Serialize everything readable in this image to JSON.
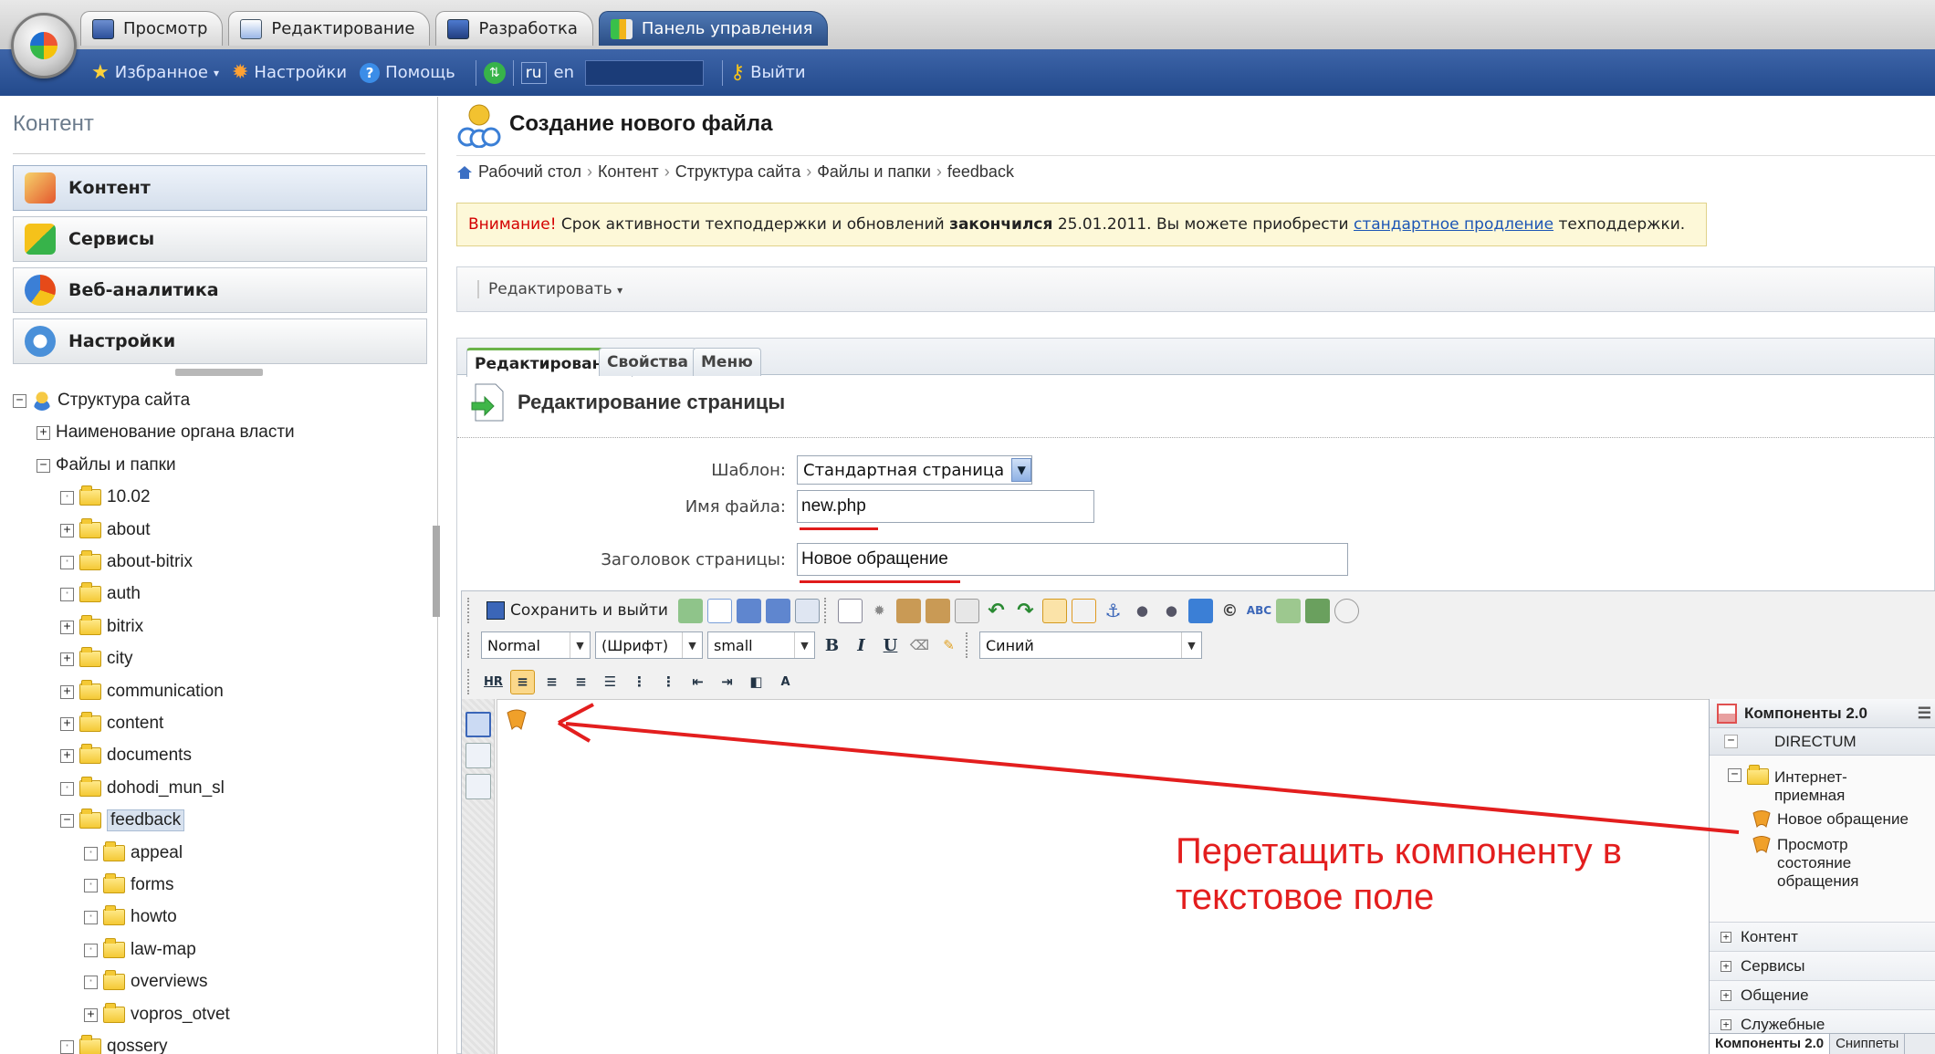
{
  "topbar": {
    "tabs": [
      {
        "label": "Просмотр",
        "icon": "view-icon"
      },
      {
        "label": "Редактирование",
        "icon": "edit-icon"
      },
      {
        "label": "Разработка",
        "icon": "develop-icon"
      },
      {
        "label": "Панель управления",
        "icon": "control-panel-icon"
      }
    ],
    "active_tab": "Панель управления",
    "favorites": "Избранное",
    "settings": "Настройки",
    "help": "Помощь",
    "lang_ru": "ru",
    "lang_en": "en",
    "logout": "Выйти"
  },
  "left": {
    "title": "Контент",
    "sections": [
      {
        "label": "Контент",
        "icon": "content-pencil-icon",
        "active": true
      },
      {
        "label": "Сервисы",
        "icon": "services-shapes-icon",
        "active": false
      },
      {
        "label": "Веб-аналитика",
        "icon": "analytics-pie-icon",
        "active": false
      },
      {
        "label": "Настройки",
        "icon": "settings-gear-icon",
        "active": false
      }
    ],
    "tree": [
      {
        "label": "Структура сайта",
        "level": 0,
        "toggle": "-",
        "kind": "site"
      },
      {
        "label": "Наименование органа власти",
        "level": 1,
        "toggle": "+",
        "kind": "none"
      },
      {
        "label": "Файлы и папки",
        "level": 1,
        "toggle": "-",
        "kind": "none"
      },
      {
        "label": "10.02",
        "level": 2,
        "toggle": " ",
        "kind": "folder"
      },
      {
        "label": "about",
        "level": 2,
        "toggle": "+",
        "kind": "folder"
      },
      {
        "label": "about-bitrix",
        "level": 2,
        "toggle": " ",
        "kind": "folder"
      },
      {
        "label": "auth",
        "level": 2,
        "toggle": " ",
        "kind": "folder"
      },
      {
        "label": "bitrix",
        "level": 2,
        "toggle": "+",
        "kind": "folder"
      },
      {
        "label": "city",
        "level": 2,
        "toggle": "+",
        "kind": "folder"
      },
      {
        "label": "communication",
        "level": 2,
        "toggle": "+",
        "kind": "folder"
      },
      {
        "label": "content",
        "level": 2,
        "toggle": "+",
        "kind": "folder"
      },
      {
        "label": "documents",
        "level": 2,
        "toggle": "+",
        "kind": "folder"
      },
      {
        "label": "dohodi_mun_sl",
        "level": 2,
        "toggle": " ",
        "kind": "folder"
      },
      {
        "label": "feedback",
        "level": 2,
        "toggle": "-",
        "kind": "folder",
        "selected": true
      },
      {
        "label": "appeal",
        "level": 3,
        "toggle": " ",
        "kind": "folder"
      },
      {
        "label": "forms",
        "level": 3,
        "toggle": " ",
        "kind": "folder"
      },
      {
        "label": "howto",
        "level": 3,
        "toggle": " ",
        "kind": "folder"
      },
      {
        "label": "law-map",
        "level": 3,
        "toggle": " ",
        "kind": "folder"
      },
      {
        "label": "overviews",
        "level": 3,
        "toggle": " ",
        "kind": "folder"
      },
      {
        "label": "vopros_otvet",
        "level": 3,
        "toggle": "+",
        "kind": "folder"
      },
      {
        "label": "qossery",
        "level": 2,
        "toggle": " ",
        "kind": "folder"
      }
    ]
  },
  "main": {
    "title": "Создание нового файла",
    "breadcrumb": [
      "Рабочий стол",
      "Контент",
      "Структура сайта",
      "Файлы и папки",
      "feedback"
    ],
    "warning": {
      "prefix": "Внимание!",
      "text1": " Срок активности техподдержки и обновлений ",
      "bold": "закончился",
      "text2": " 25.01.2011. Вы можете приобрести ",
      "link": "стандартное продление",
      "text3": " техподдержки."
    },
    "edit_menu": "Редактировать",
    "tabs": [
      "Редактирование",
      "Свойства",
      "Меню"
    ],
    "section_title": "Редактирование страницы",
    "form": {
      "template_label": "Шаблон:",
      "template_value": "Стандартная страница",
      "filename_label": "Имя файла:",
      "filename_value": "new.php",
      "title_label": "Заголовок страницы:",
      "title_value": "Новое обращение"
    },
    "editor": {
      "save_exit": "Сохранить и выйти",
      "style": "Normal",
      "font": "(Шрифт)",
      "size": "small",
      "color": "Синий",
      "hr": "HR",
      "bold": "B",
      "italic": "I",
      "underline": "U"
    },
    "components": {
      "title": "Компоненты 2.0",
      "group": "DIRECTUM",
      "folder": "Интернет-приемная",
      "items": [
        "Новое обращение",
        "Просмотр состояние обращения"
      ],
      "groups": [
        "Контент",
        "Сервисы",
        "Общение",
        "Служебные"
      ],
      "bottom_tabs": [
        "Компоненты 2.0",
        "Сниппеты"
      ]
    },
    "instruction": "Перетащить компоненту в текстовое поле",
    "accent_red": "#e31e1e"
  }
}
